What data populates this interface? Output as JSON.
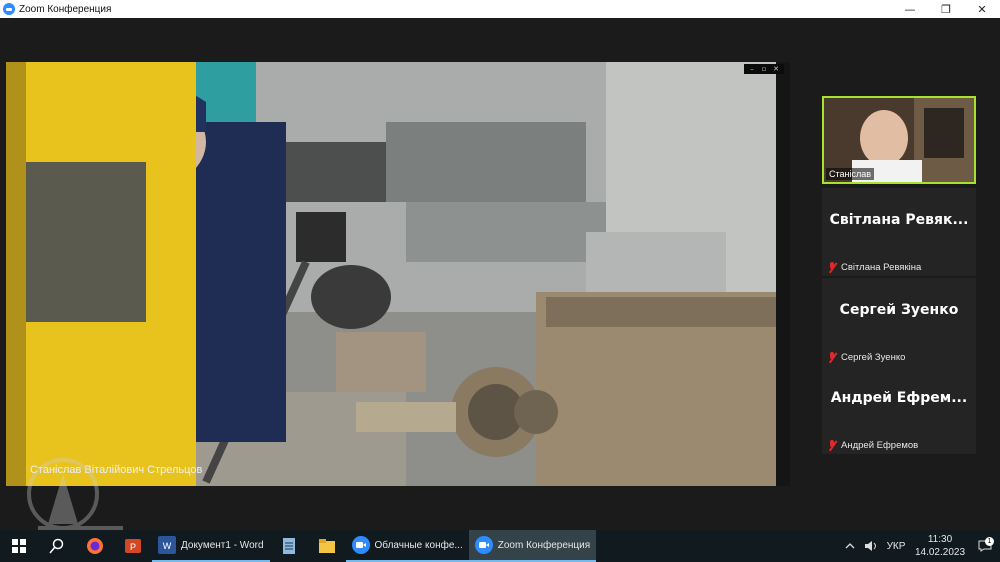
{
  "window": {
    "title": "Zoom Конференция",
    "controls": {
      "minimize": "—",
      "maximize": "❐",
      "close": "✕"
    }
  },
  "main_video": {
    "speaker_name": "Станіслав Віталійович Стрельцов",
    "controls": [
      "–",
      "▫",
      "✕"
    ]
  },
  "participants": [
    {
      "tile_label": "Станіслав",
      "has_video": true
    },
    {
      "big_name": "Світлана Ревяк...",
      "name": "Світлана Ревякіна",
      "muted": true
    },
    {
      "big_name": "Сергей Зуенко",
      "name": "Сергей Зуенко",
      "muted": true
    },
    {
      "big_name": "Андрей Ефрем...",
      "name": "Андрей Ефремов",
      "muted": true
    }
  ],
  "taskbar": {
    "apps": [
      {
        "label": "Документ1 - Word",
        "icon": "word-icon"
      },
      {
        "label": "Облачные конфе...",
        "icon": "zoom-icon"
      },
      {
        "label": "Zoom Конференция",
        "icon": "zoom-icon",
        "active": true
      }
    ],
    "tray": {
      "language": "УКР",
      "time": "11:30",
      "date": "14.02.2023",
      "notification_count": "1"
    }
  },
  "colors": {
    "active_speaker_border": "#a6e22e",
    "mute_red": "#e02828",
    "zoom_blue": "#2d8cff"
  }
}
